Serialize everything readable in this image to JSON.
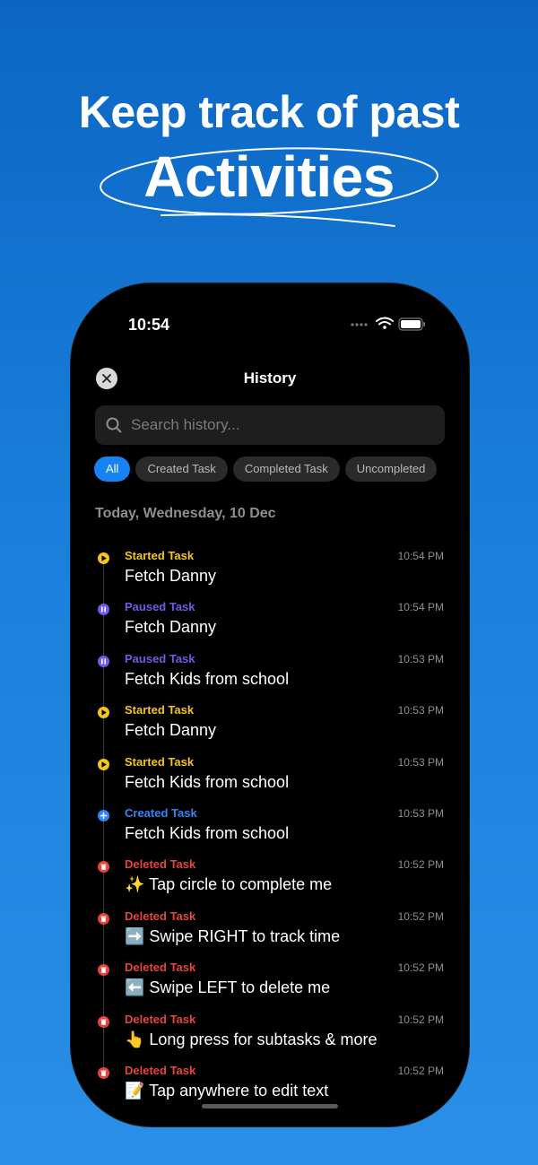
{
  "marketing": {
    "headline_line1": "Keep track of past",
    "headline_line2": "Activities"
  },
  "status_bar": {
    "time": "10:54"
  },
  "nav": {
    "title": "History"
  },
  "search": {
    "placeholder": "Search history..."
  },
  "filters": [
    {
      "label": "All",
      "active": true
    },
    {
      "label": "Created Task",
      "active": false
    },
    {
      "label": "Completed Task",
      "active": false
    },
    {
      "label": "Uncompleted",
      "active": false
    }
  ],
  "section": {
    "header": "Today, Wednesday, 10 Dec"
  },
  "colors": {
    "started": "#f5c518",
    "paused": "#6e5ce6",
    "created": "#2f86f5",
    "deleted": "#e5453b",
    "accent": "#1682f3"
  },
  "history": [
    {
      "type": "Started Task",
      "kind": "started",
      "title": "Fetch Danny",
      "time": "10:54 PM"
    },
    {
      "type": "Paused Task",
      "kind": "paused",
      "title": "Fetch Danny",
      "time": "10:54 PM"
    },
    {
      "type": "Paused Task",
      "kind": "paused",
      "title": "Fetch Kids from school",
      "time": "10:53 PM"
    },
    {
      "type": "Started Task",
      "kind": "started",
      "title": "Fetch Danny",
      "time": "10:53 PM"
    },
    {
      "type": "Started Task",
      "kind": "started",
      "title": "Fetch Kids from school",
      "time": "10:53 PM"
    },
    {
      "type": "Created Task",
      "kind": "created",
      "title": "Fetch Kids from school",
      "time": "10:53 PM"
    },
    {
      "type": "Deleted Task",
      "kind": "deleted",
      "title": "✨ Tap circle to complete me",
      "time": "10:52 PM"
    },
    {
      "type": "Deleted Task",
      "kind": "deleted",
      "title": "➡️ Swipe RIGHT to track time",
      "time": "10:52 PM"
    },
    {
      "type": "Deleted Task",
      "kind": "deleted",
      "title": "⬅️ Swipe LEFT to delete me",
      "time": "10:52 PM"
    },
    {
      "type": "Deleted Task",
      "kind": "deleted",
      "title": "👆 Long press for subtasks & more",
      "time": "10:52 PM"
    },
    {
      "type": "Deleted Task",
      "kind": "deleted",
      "title": "📝 Tap anywhere to edit text",
      "time": "10:52 PM"
    }
  ]
}
